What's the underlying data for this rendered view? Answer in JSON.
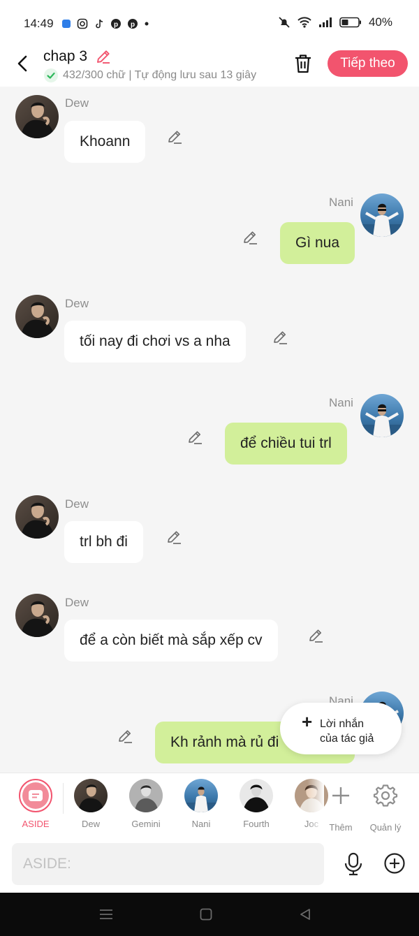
{
  "status_bar": {
    "time": "14:49",
    "battery": "40%"
  },
  "header": {
    "title": "chap 3",
    "word_count": "432/300 chữ",
    "separator": "|",
    "autosave": "Tự động lưu sau 13 giây",
    "next_button": "Tiếp theo"
  },
  "messages": [
    {
      "sender": "Dew",
      "side": "left",
      "text": "Khoann"
    },
    {
      "sender": "Nani",
      "side": "right",
      "text": "Gì nua"
    },
    {
      "sender": "Dew",
      "side": "left",
      "text": "tối nay đi chơi vs a nha"
    },
    {
      "sender": "Nani",
      "side": "right",
      "text": "để chiều tui trl"
    },
    {
      "sender": "Dew",
      "side": "left",
      "text": "trl bh đi"
    },
    {
      "sender": "Dew",
      "side": "left",
      "text": "để a còn biết mà sắp xếp cv"
    },
    {
      "sender": "Nani",
      "side": "right",
      "text": "Kh rảnh mà rủ đi"
    }
  ],
  "author_note": {
    "line1": "Lời nhắn",
    "line2": "của tác giả"
  },
  "characters": {
    "aside": "ASIDE",
    "c1": "Dew",
    "c2": "Gemini",
    "c3": "Nani",
    "c4": "Fourth",
    "c5": "Joc",
    "add": "Thêm",
    "manage": "Quản lý"
  },
  "input": {
    "placeholder": "ASIDE:"
  },
  "colors": {
    "accent": "#f2546e",
    "right_bubble": "#d2ef9a",
    "left_bubble": "#ffffff",
    "background": "#f5f5f5"
  }
}
